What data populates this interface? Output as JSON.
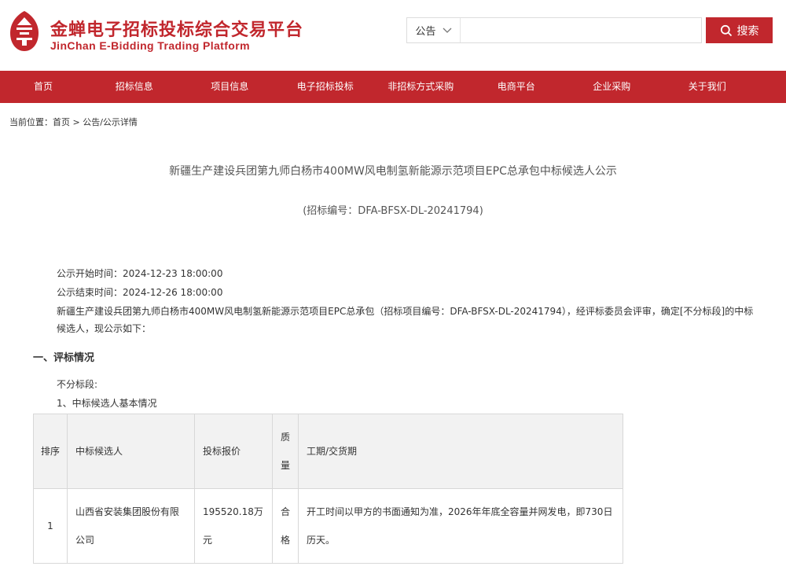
{
  "brand": {
    "name_cn": "金蝉电子招标投标综合交易平台",
    "name_en": "JinChan E-Bidding Trading Platform",
    "primary_color": "#c1272d"
  },
  "search": {
    "category": "公告",
    "placeholder": "",
    "button_label": "搜索"
  },
  "nav": {
    "items": [
      {
        "label": "首页"
      },
      {
        "label": "招标信息"
      },
      {
        "label": "项目信息"
      },
      {
        "label": "电子招标投标"
      },
      {
        "label": "非招标方式采购"
      },
      {
        "label": "电商平台"
      },
      {
        "label": "企业采购"
      },
      {
        "label": "关于我们"
      }
    ]
  },
  "breadcrumb": {
    "prefix": "当前位置：",
    "home": "首页",
    "separator": " > ",
    "current": "公告/公示详情"
  },
  "article": {
    "title": "新疆生产建设兵团第九师白杨市400MW风电制氢新能源示范项目EPC总承包中标候选人公示",
    "code": "(招标编号：DFA-BFSX-DL-20241794)",
    "start_time": "公示开始时间：2024-12-23 18:00:00",
    "end_time": "公示结束时间：2024-12-26 18:00:00",
    "intro": "新疆生产建设兵团第九师白杨市400MW风电制氢新能源示范项目EPC总承包（招标项目编号：DFA-BFSX-DL-20241794），经评标委员会评审，确定[不分标段]的中标候选人，现公示如下：",
    "section1": "一、评标情况",
    "section_label": "不分标段:",
    "subsection": "1、中标候选人基本情况"
  },
  "table": {
    "headers": {
      "rank": "排序",
      "candidate": "中标候选人",
      "price": "投标报价",
      "quality": "质量",
      "period": "工期/交货期"
    },
    "rows": [
      {
        "rank": "1",
        "candidate": "山西省安装集团股份有限公司",
        "price": "195520.18万元",
        "quality": "合格",
        "period": "开工时间以甲方的书面通知为准，2026年年底全容量并网发电，即730日历天。"
      }
    ]
  }
}
